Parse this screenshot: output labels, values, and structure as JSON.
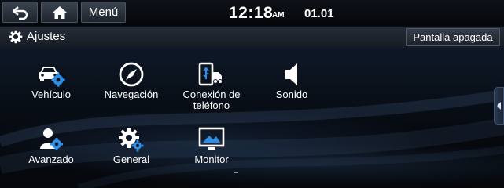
{
  "statusbar": {
    "back_icon": "back-arrow-icon",
    "home_icon": "home-icon",
    "menu_label": "Menú",
    "time": "12:18",
    "ampm": "AM",
    "date": "01.01"
  },
  "titlebar": {
    "icon": "gear-icon",
    "title": "Ajustes",
    "screen_off_label": "Pantalla apagada"
  },
  "tiles": [
    {
      "label": "Vehículo",
      "icon": "vehicle-settings-icon"
    },
    {
      "label": "Navegación",
      "icon": "compass-icon"
    },
    {
      "label": "Conexión de\nteléfono",
      "icon": "phone-connection-icon"
    },
    {
      "label": "Sonido",
      "icon": "speaker-icon"
    },
    {
      "label": "Avanzado",
      "icon": "user-settings-icon"
    },
    {
      "label": "General",
      "icon": "gears-icon"
    },
    {
      "label": "Monitor",
      "icon": "monitor-icon"
    }
  ],
  "colors": {
    "accent_blue": "#2f8fe6",
    "background": "#05080d"
  }
}
